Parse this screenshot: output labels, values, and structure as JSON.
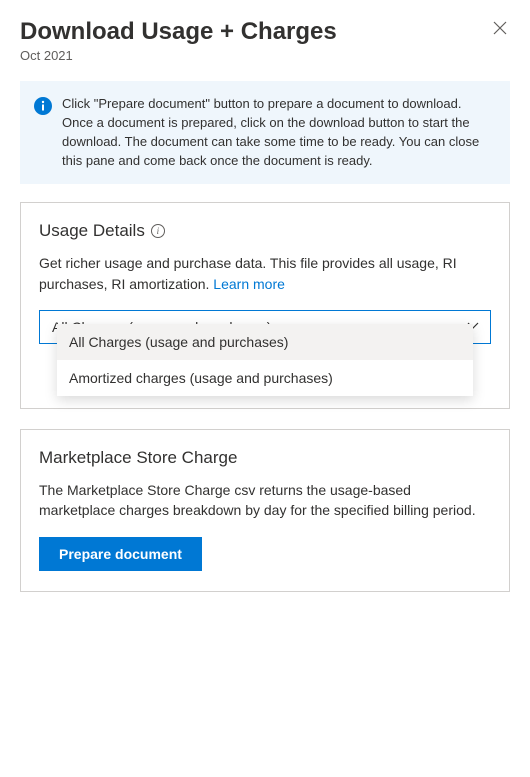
{
  "header": {
    "title": "Download Usage + Charges",
    "subtitle": "Oct 2021"
  },
  "info": {
    "text": "Click \"Prepare document\" button to prepare a document to download. Once a document is prepared, click on the download button to start the download. The document can take some time to be ready. You can close this pane and come back once the document is ready."
  },
  "usage": {
    "title": "Usage Details",
    "desc_prefix": "Get richer usage and purchase data. This file provides all usage, RI purchases, RI amortization. ",
    "learn_more": "Learn more",
    "select_value": "All Charges (usage and purchases)",
    "options": [
      "All Charges (usage and purchases)",
      "Amortized charges (usage and purchases)"
    ]
  },
  "marketplace": {
    "title": "Marketplace Store Charge",
    "desc": "The Marketplace Store Charge csv returns the usage-based marketplace charges breakdown by day for the specified billing period.",
    "button": "Prepare document"
  }
}
